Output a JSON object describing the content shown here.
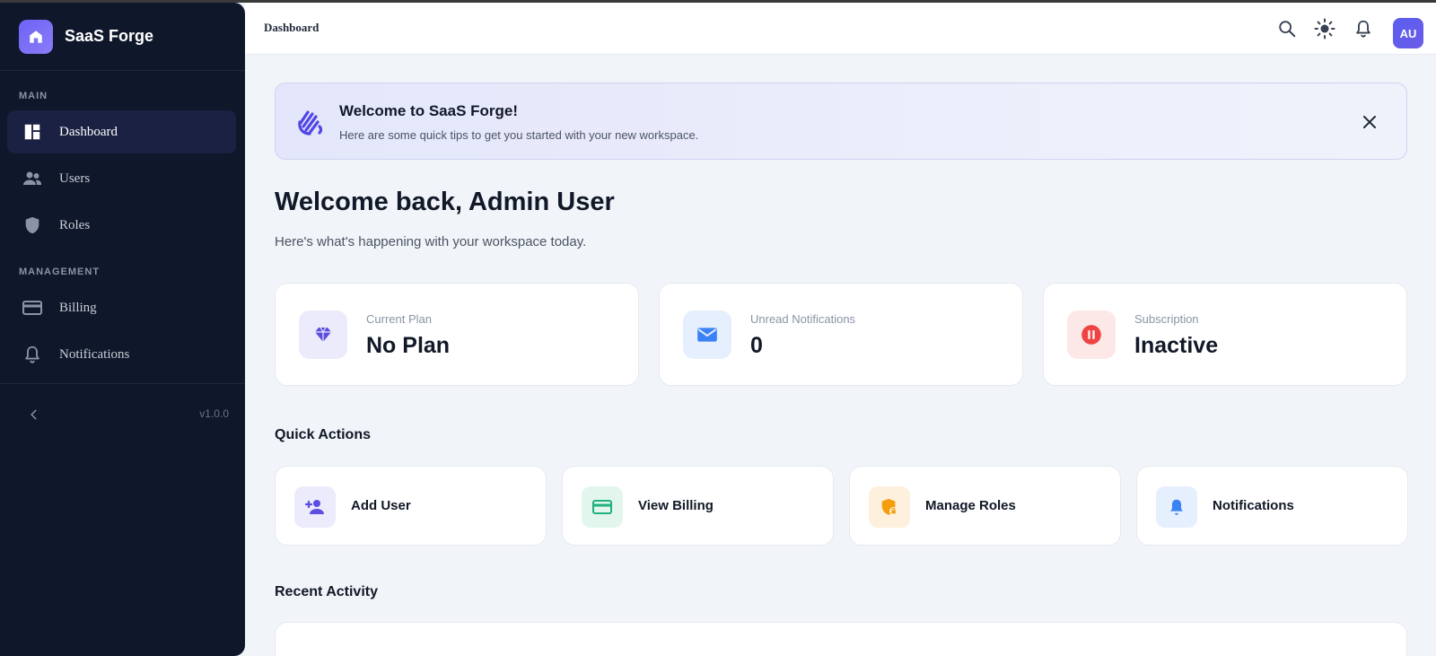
{
  "brand": {
    "name": "SaaS Forge"
  },
  "sidebar": {
    "sections": [
      {
        "label": "MAIN"
      },
      {
        "label": "MANAGEMENT"
      }
    ],
    "items": [
      {
        "label": "Dashboard",
        "icon": "dashboard-icon",
        "active": true
      },
      {
        "label": "Users",
        "icon": "users-icon"
      },
      {
        "label": "Roles",
        "icon": "shield-icon"
      },
      {
        "label": "Billing",
        "icon": "credit-card-icon"
      },
      {
        "label": "Notifications",
        "icon": "bell-icon"
      }
    ],
    "version": "v1.0.0"
  },
  "header": {
    "title": "Dashboard",
    "avatar_initials": "AU"
  },
  "banner": {
    "title": "Welcome to SaaS Forge!",
    "subtitle": "Here are some quick tips to get you started with your new workspace."
  },
  "welcome": {
    "title": "Welcome back, Admin User",
    "subtitle": "Here's what's happening with your workspace today."
  },
  "stats": [
    {
      "label": "Current Plan",
      "value": "No Plan",
      "icon": "gem-icon",
      "color": "#5b4ee0",
      "bg": "#ecebfb"
    },
    {
      "label": "Unread Notifications",
      "value": "0",
      "icon": "mail-icon",
      "color": "#3b82f6",
      "bg": "#e6effd"
    },
    {
      "label": "Subscription",
      "value": "Inactive",
      "icon": "pause-icon",
      "color": "#ef4444",
      "bg": "#fde8e8"
    }
  ],
  "quick_actions": {
    "title": "Quick Actions",
    "items": [
      {
        "label": "Add User",
        "icon": "add-user-icon",
        "color": "#5b4ee0",
        "bg": "#ecebfb"
      },
      {
        "label": "View Billing",
        "icon": "credit-card-icon",
        "color": "#22b07d",
        "bg": "#e3f6ee"
      },
      {
        "label": "Manage Roles",
        "icon": "shield-lock-icon",
        "color": "#f59e0b",
        "bg": "#fdf0dc"
      },
      {
        "label": "Notifications",
        "icon": "bell-icon",
        "color": "#3b82f6",
        "bg": "#e6effd"
      }
    ]
  },
  "recent_activity": {
    "title": "Recent Activity"
  }
}
